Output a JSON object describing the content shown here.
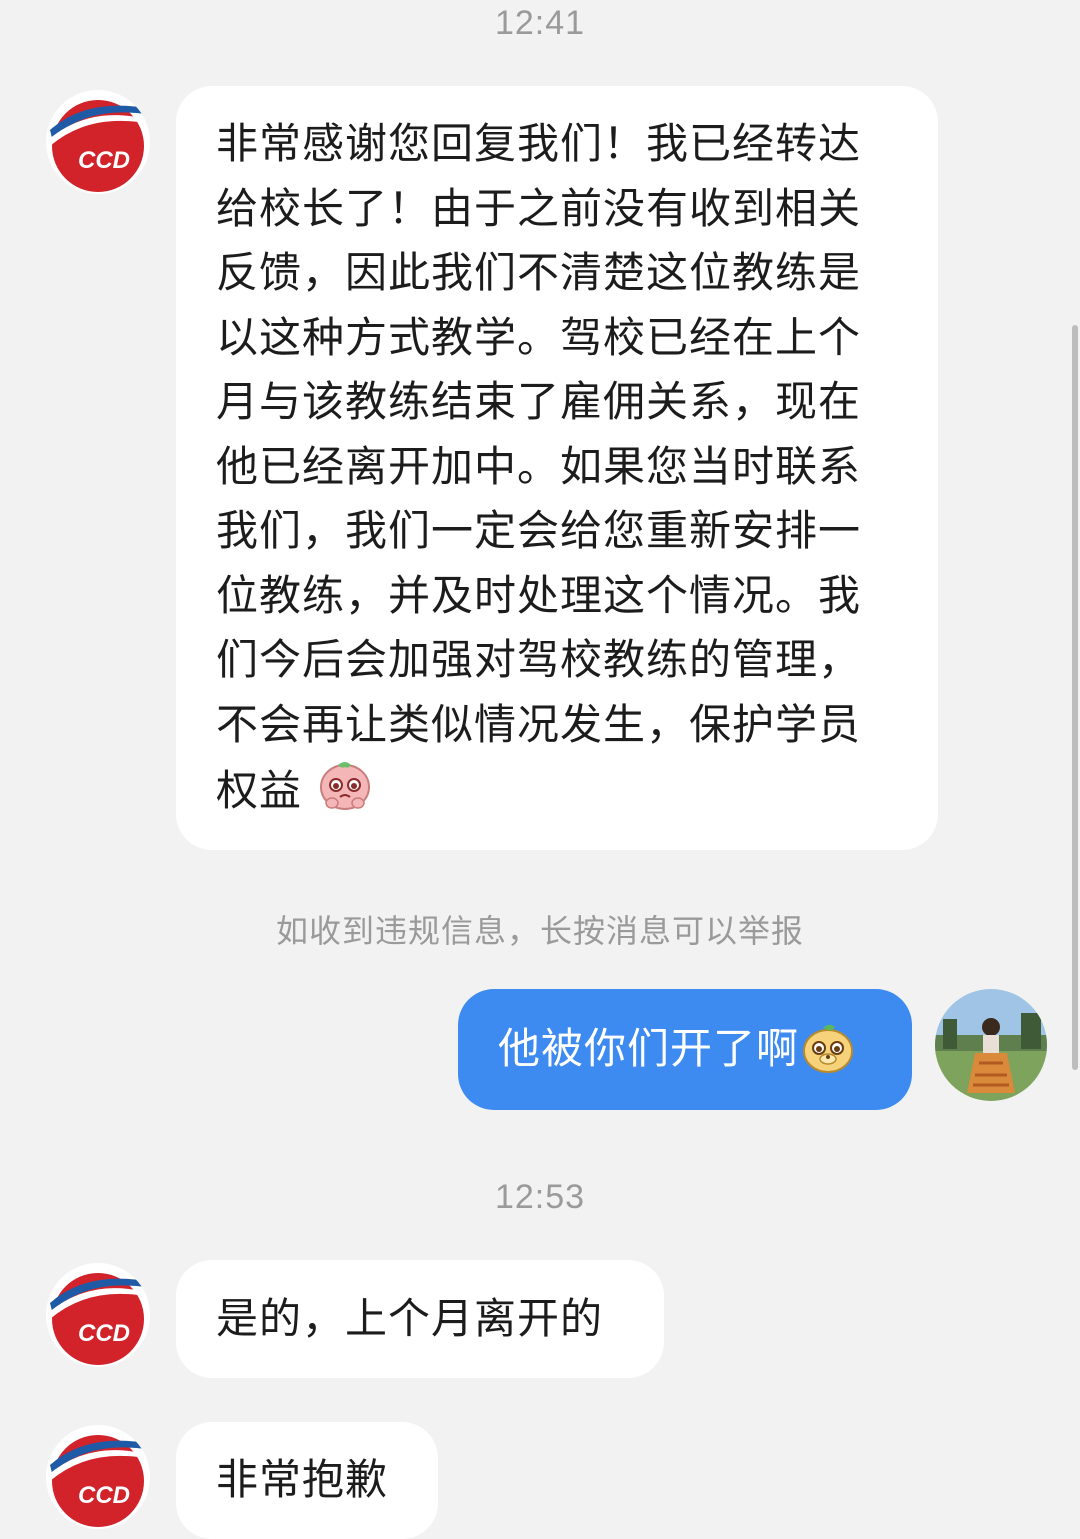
{
  "timestamps": [
    "12:41",
    "12:53"
  ],
  "sender": {
    "avatar_logo_text": "CCD"
  },
  "messages": {
    "m1": {
      "lines": [
        "非常感谢您回复我们！我已经转达",
        "给校长了！由于之前没有收到相关",
        "反馈，因此我们不清楚这位教练是",
        "以这种方式教学。驾校已经在上个",
        "月与该教练结束了雇佣关系，现在",
        "他已经离开加中。如果您当时联系",
        "我们，我们一定会给您重新安排一",
        "位教练，并及时处理这个情况。我",
        "们今后会加强对驾校教练的管理，",
        "不会再让类似情况发生，保护学员",
        "权益"
      ],
      "emoji": "pleading-face-emoji"
    },
    "m2": {
      "text": "他被你们开了啊",
      "emoji": "dog-face-emoji"
    },
    "m3": {
      "text": "是的，上个月离开的"
    },
    "m4": {
      "text": "非常抱歉"
    }
  },
  "notice": "如收到违规信息，长按消息可以举报",
  "colors": {
    "background": "#f2f2f2",
    "incoming_bubble": "#ffffff",
    "outgoing_bubble": "#3d8bf0",
    "meta_text": "#9a9a9a",
    "logo_red": "#d2232a",
    "logo_blue": "#1f5aa6"
  }
}
